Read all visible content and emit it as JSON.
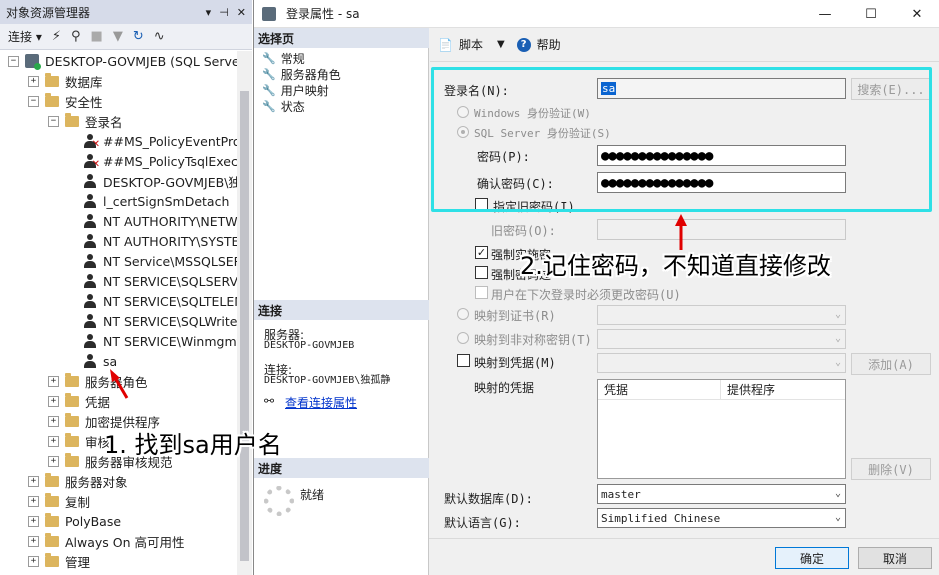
{
  "object_explorer": {
    "title": "对象资源管理器",
    "title_buttons": [
      "▾",
      "⊣",
      "✕"
    ],
    "toolbar": {
      "connect_label": "连接"
    },
    "tree": [
      {
        "label": "DESKTOP-GOVMJEB (SQL Serve",
        "level": 0,
        "exp": "−",
        "icon": "server-icon"
      },
      {
        "label": "数据库",
        "level": 1,
        "exp": "+",
        "icon": "folder-icon"
      },
      {
        "label": "安全性",
        "level": 1,
        "exp": "−",
        "icon": "folder-icon"
      },
      {
        "label": "登录名",
        "level": 2,
        "exp": "−",
        "icon": "folder-icon"
      },
      {
        "label": "##MS_PolicyEventProc",
        "level": 3,
        "exp": "",
        "icon": "disabled-user-icon"
      },
      {
        "label": "##MS_PolicyTsqlExecu",
        "level": 3,
        "exp": "",
        "icon": "disabled-user-icon"
      },
      {
        "label": "DESKTOP-GOVMJEB\\独",
        "level": 3,
        "exp": "",
        "icon": "user-icon"
      },
      {
        "label": "l_certSignSmDetach",
        "level": 3,
        "exp": "",
        "icon": "user-icon"
      },
      {
        "label": "NT AUTHORITY\\NETW",
        "level": 3,
        "exp": "",
        "icon": "user-icon"
      },
      {
        "label": "NT AUTHORITY\\SYSTE",
        "level": 3,
        "exp": "",
        "icon": "user-icon"
      },
      {
        "label": "NT Service\\MSSQLSER",
        "level": 3,
        "exp": "",
        "icon": "user-icon"
      },
      {
        "label": "NT SERVICE\\SQLSERVI",
        "level": 3,
        "exp": "",
        "icon": "user-icon"
      },
      {
        "label": "NT SERVICE\\SQLTELEM",
        "level": 3,
        "exp": "",
        "icon": "user-icon"
      },
      {
        "label": "NT SERVICE\\SQLWrite",
        "level": 3,
        "exp": "",
        "icon": "user-icon"
      },
      {
        "label": "NT SERVICE\\Winmgmt",
        "level": 3,
        "exp": "",
        "icon": "user-icon"
      },
      {
        "label": "sa",
        "level": 3,
        "exp": "",
        "icon": "user-icon"
      },
      {
        "label": "服务器角色",
        "level": 2,
        "exp": "+",
        "icon": "folder-icon"
      },
      {
        "label": "凭据",
        "level": 2,
        "exp": "+",
        "icon": "folder-icon"
      },
      {
        "label": "加密提供程序",
        "level": 2,
        "exp": "+",
        "icon": "folder-icon"
      },
      {
        "label": "审核",
        "level": 2,
        "exp": "+",
        "icon": "folder-icon"
      },
      {
        "label": "服务器审核规范",
        "level": 2,
        "exp": "+",
        "icon": "folder-icon"
      },
      {
        "label": "服务器对象",
        "level": 1,
        "exp": "+",
        "icon": "folder-icon"
      },
      {
        "label": "复制",
        "level": 1,
        "exp": "+",
        "icon": "folder-icon"
      },
      {
        "label": "PolyBase",
        "level": 1,
        "exp": "+",
        "icon": "folder-icon"
      },
      {
        "label": "Always On 高可用性",
        "level": 1,
        "exp": "+",
        "icon": "folder-icon"
      },
      {
        "label": "管理",
        "level": 1,
        "exp": "+",
        "icon": "folder-icon"
      }
    ]
  },
  "dialog": {
    "title": "登录属性 - sa",
    "window_buttons": [
      "—",
      "☐",
      "✕"
    ],
    "select_page": {
      "header": "选择页",
      "items": [
        "常规",
        "服务器角色",
        "用户映射",
        "状态"
      ]
    },
    "connection": {
      "header": "连接",
      "server_label": "服务器:",
      "server_value": "DESKTOP-GOVMJEB",
      "conn_label": "连接:",
      "conn_value": "DESKTOP-GOVMJEB\\独孤静",
      "view_link": "查看连接属性"
    },
    "progress": {
      "header": "进度",
      "status": "就绪"
    },
    "toolbar": {
      "script_label": "脚本",
      "help_label": "帮助"
    },
    "form": {
      "login_name_label": "登录名(N):",
      "login_name_value": "sa",
      "search_button": "搜索(E)...",
      "windows_auth": "Windows 身份验证(W)",
      "sql_auth": "SQL Server 身份验证(S)",
      "password_label": "密码(P):",
      "password_value": "●●●●●●●●●●●●●●●",
      "confirm_label": "确认密码(C):",
      "confirm_value": "●●●●●●●●●●●●●●●",
      "specify_old": "指定旧密码(I)",
      "old_password_label": "旧密码(O):",
      "enforce_policy": "强制实施密码策略",
      "enforce_expiration": "强制密码过期",
      "must_change": "用户在下次登录时必须更改密码(U)",
      "map_cert": "映射到证书(R)",
      "map_asym": "映射到非对称密钥(T)",
      "map_credential": "映射到凭据(M)",
      "add_button": "添加(A)",
      "mapped_credentials": "映射的凭据",
      "grid_col_credential": "凭据",
      "grid_col_provider": "提供程序",
      "remove_button": "删除(V)",
      "default_db_label": "默认数据库(D):",
      "default_db_value": "master",
      "default_lang_label": "默认语言(G):",
      "default_lang_value": "Simplified Chinese"
    },
    "ok_button": "确定",
    "cancel_button": "取消"
  },
  "annotations": {
    "step1": "1. 找到sa用户名",
    "step2": "2.记住密码，不知道直接修改"
  },
  "colors": {
    "highlight_border": "#2ee0e6",
    "arrow_red": "#e00000",
    "selection_blue": "#0a64d0"
  }
}
